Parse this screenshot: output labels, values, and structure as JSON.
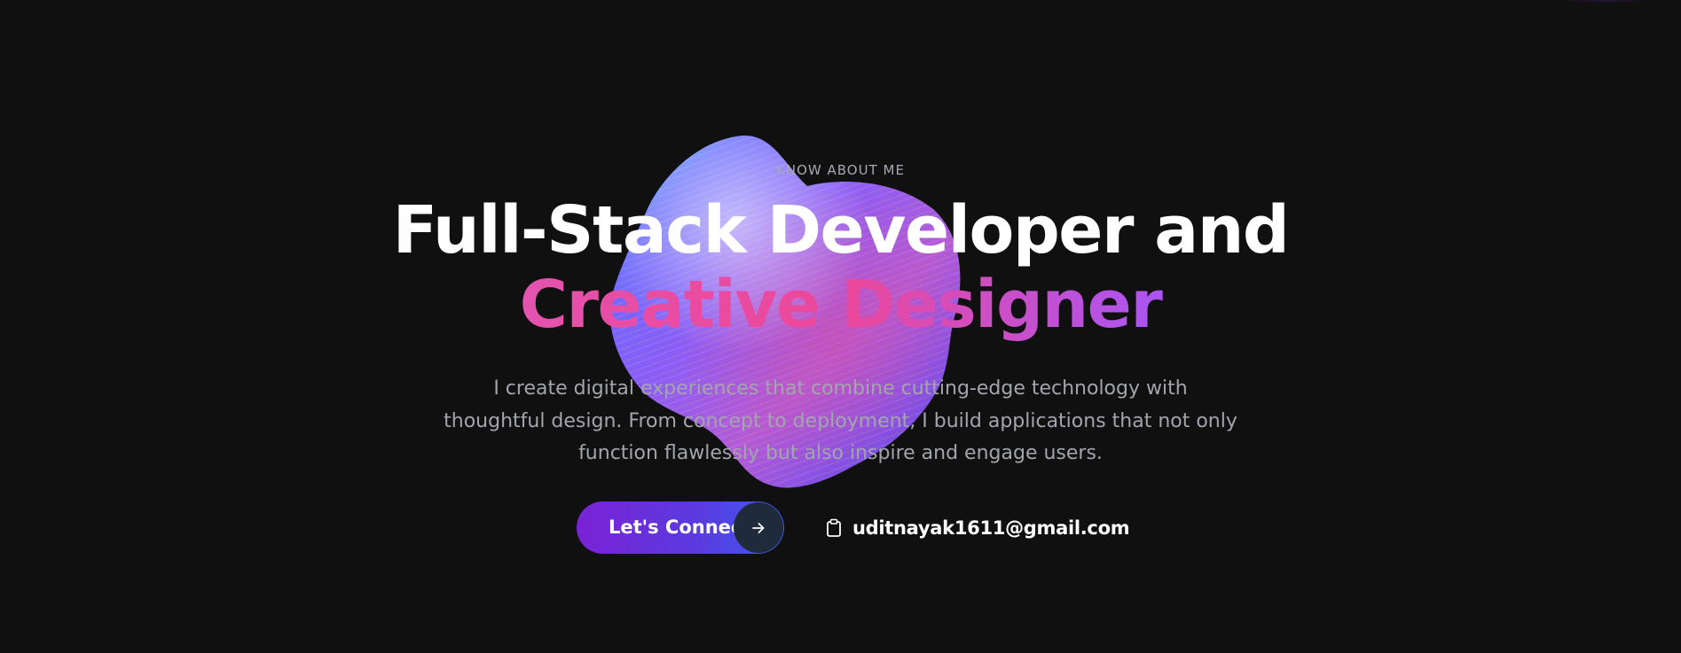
{
  "hero": {
    "eyebrow": "KNOW ABOUT ME",
    "headline_line1": "Full-Stack Developer and",
    "headline_line2": "Creative Designer",
    "bio": "I create digital experiences that combine cutting-edge technology with thoughtful design. From concept to deployment, I build applications that not only function flawlessly but also inspire and engage users."
  },
  "cta": {
    "connect_label": "Let's Connect",
    "connect_icon": "arrow-right-icon",
    "email_icon": "clipboard-icon",
    "email": "uditnayak1611@gmail.com"
  },
  "colors": {
    "background": "#101011",
    "accent_purple": "#7a22d6",
    "accent_blue": "#3a5bf0",
    "gradient_pink": "#ec4899",
    "text_muted": "#a3a5ad"
  }
}
